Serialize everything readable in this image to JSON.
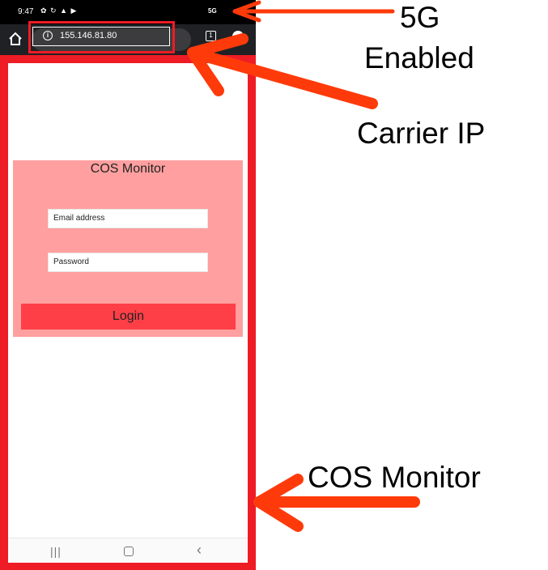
{
  "status_bar": {
    "time": "9:47",
    "icons": "✿ ↻ ▲ ▶",
    "network": "5G"
  },
  "browser": {
    "url": "155.146.81.80",
    "tab_count": "1"
  },
  "login_card": {
    "title": "COS Monitor",
    "email_placeholder": "Email address",
    "password_placeholder": "Password",
    "login_label": "Login"
  },
  "nav_bar": {
    "recent": "|||",
    "back": "‹"
  },
  "annotations": {
    "five_g_line1": "5G",
    "five_g_line2": "Enabled",
    "carrier_ip": "Carrier IP",
    "cos_monitor": "COS Monitor"
  },
  "colors": {
    "frame": "#ee1c25",
    "card": "#ff9f9f",
    "button": "#ff3f48",
    "arrow": "#ff3a0a"
  }
}
